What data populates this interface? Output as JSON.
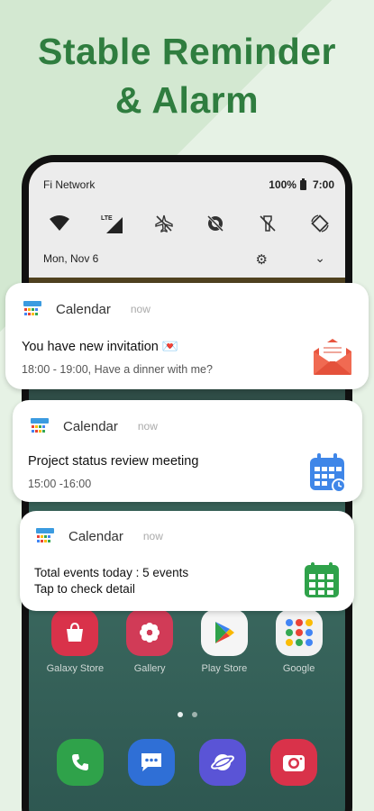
{
  "headline": {
    "line1": "Stable Reminder",
    "line2": "& Alarm"
  },
  "status_bar": {
    "carrier": "Fi Network",
    "battery": "100%",
    "time": "7:00"
  },
  "quick_settings": {
    "tiles": [
      "wifi-icon",
      "lte-signal-icon",
      "airplane-off-icon",
      "sync-off-icon",
      "flashlight-off-icon",
      "rotate-icon"
    ],
    "date": "Mon, Nov 6"
  },
  "notifications": [
    {
      "app": "Calendar",
      "time": "now",
      "title": "You have new invitation 💌",
      "text": "18:00 - 19:00, Have a dinner with me?",
      "icon": "envelope-icon"
    },
    {
      "app": "Calendar",
      "time": "now",
      "title": "Project status review meeting",
      "text": "15:00 -16:00",
      "icon": "calendar-clock-icon"
    },
    {
      "app": "Calendar",
      "time": "now",
      "title": "Total events today : 5 events",
      "text": "Tap to check detail",
      "icon": "calendar-grid-icon"
    }
  ],
  "home_apps": [
    {
      "label": "Galaxy Store",
      "icon": "shopping-bag-icon",
      "color": "#d9324a"
    },
    {
      "label": "Gallery",
      "icon": "flower-icon",
      "color": "#d13b57"
    },
    {
      "label": "Play Store",
      "icon": "play-store-icon",
      "color": "#f5f5f5"
    },
    {
      "label": "Google",
      "icon": "google-folder-icon",
      "color": "#f2f2f2"
    }
  ],
  "dock": [
    {
      "icon": "phone-icon",
      "color": "#2fa24a"
    },
    {
      "icon": "messages-icon",
      "color": "#2f6fd6"
    },
    {
      "icon": "internet-icon",
      "color": "#5a54d6"
    },
    {
      "icon": "camera-icon",
      "color": "#d9324a"
    }
  ],
  "colors": {
    "accent": "#2f7d3f",
    "background": "#e3f0e2"
  }
}
